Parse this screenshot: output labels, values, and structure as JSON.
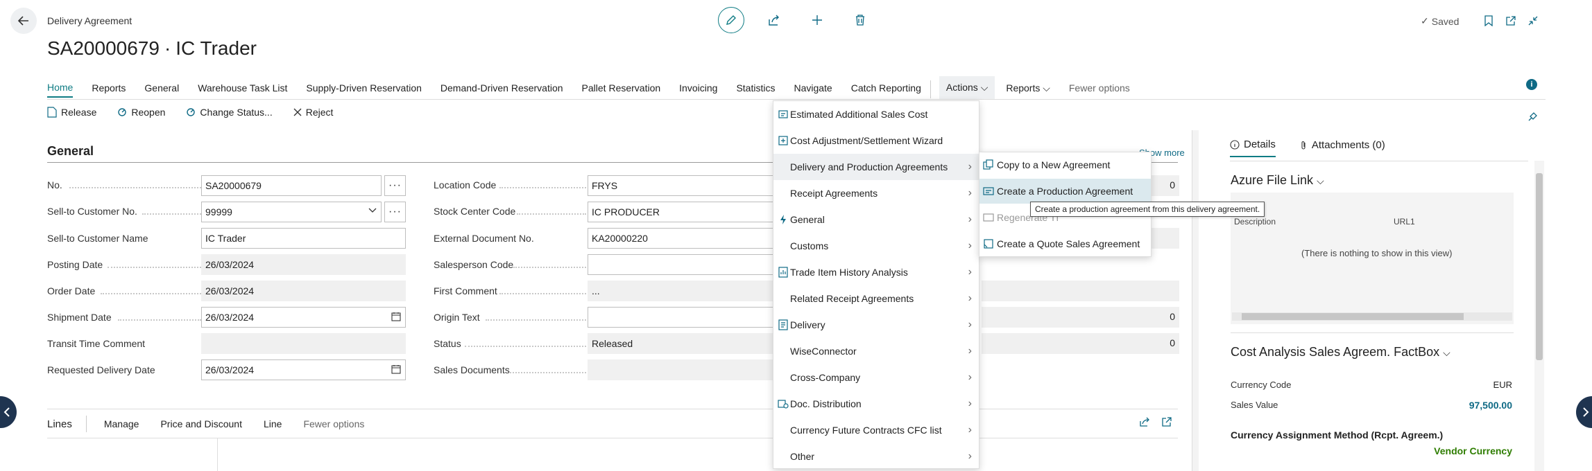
{
  "header": {
    "subtitle": "Delivery Agreement",
    "title": "SA20000679 ∙ IC Trader",
    "saved": "Saved"
  },
  "tabs": [
    {
      "label": "Home"
    },
    {
      "label": "Reports"
    },
    {
      "label": "General"
    },
    {
      "label": "Warehouse Task List"
    },
    {
      "label": "Supply-Driven Reservation"
    },
    {
      "label": "Demand-Driven Reservation"
    },
    {
      "label": "Pallet Reservation"
    },
    {
      "label": "Invoicing"
    },
    {
      "label": "Statistics"
    },
    {
      "label": "Navigate"
    },
    {
      "label": "Catch Reporting"
    }
  ],
  "tabs_right": {
    "actions": "Actions",
    "reports": "Reports",
    "fewer": "Fewer options"
  },
  "toolbar": {
    "release": "Release",
    "reopen": "Reopen",
    "change_status": "Change Status...",
    "reject": "Reject"
  },
  "general": {
    "title": "General",
    "show_more": "Show more",
    "left_fields": [
      {
        "label": "No.",
        "value": "SA20000679"
      },
      {
        "label": "Sell-to Customer No.",
        "value": "99999"
      },
      {
        "label": "Sell-to Customer Name",
        "value": "IC Trader"
      },
      {
        "label": "Posting Date",
        "value": "26/03/2024"
      },
      {
        "label": "Order Date",
        "value": "26/03/2024"
      },
      {
        "label": "Shipment Date",
        "value": "26/03/2024"
      },
      {
        "label": "Transit Time Comment",
        "value": ""
      },
      {
        "label": "Requested Delivery Date",
        "value": "26/03/2024"
      }
    ],
    "mid_fields": [
      {
        "label": "Location Code",
        "value": "FRYS"
      },
      {
        "label": "Stock Center Code",
        "value": "IC PRODUCER"
      },
      {
        "label": "External Document No.",
        "value": "KA20000220"
      },
      {
        "label": "Salesperson Code",
        "value": ""
      },
      {
        "label": "First Comment",
        "value": "..."
      },
      {
        "label": "Origin Text",
        "value": ""
      },
      {
        "label": "Status",
        "value": "Released"
      },
      {
        "label": "Sales Documents",
        "value": ""
      }
    ],
    "right_values": [
      "0",
      "",
      "",
      "",
      "",
      "0",
      "0"
    ]
  },
  "lines_bar": {
    "lines": "Lines",
    "manage": "Manage",
    "price": "Price and Discount",
    "line": "Line",
    "fewer": "Fewer options"
  },
  "actions_menu": [
    {
      "label": "Estimated Additional Sales Cost",
      "icon": "cost-icon",
      "sub": false
    },
    {
      "label": "Cost Adjustment/Settlement Wizard",
      "icon": "wizard-icon",
      "sub": false
    },
    {
      "label": "Delivery and Production Agreements",
      "icon": "",
      "sub": true
    },
    {
      "label": "Receipt Agreements",
      "icon": "",
      "sub": true
    },
    {
      "label": "General",
      "icon": "lightning-icon",
      "sub": true
    },
    {
      "label": "Customs",
      "icon": "",
      "sub": true
    },
    {
      "label": "Trade Item History Analysis",
      "icon": "analysis-icon",
      "sub": true
    },
    {
      "label": "Related Receipt Agreements",
      "icon": "",
      "sub": true
    },
    {
      "label": "Delivery",
      "icon": "document-icon",
      "sub": true
    },
    {
      "label": "WiseConnector",
      "icon": "",
      "sub": true
    },
    {
      "label": "Cross-Company",
      "icon": "",
      "sub": true
    },
    {
      "label": "Doc. Distribution",
      "icon": "distribution-icon",
      "sub": true
    },
    {
      "label": "Currency Future Contracts CFC list",
      "icon": "",
      "sub": true
    },
    {
      "label": "Other",
      "icon": "",
      "sub": true
    }
  ],
  "submenu": [
    {
      "label": "Copy to a New Agreement"
    },
    {
      "label": "Create a Production Agreement"
    },
    {
      "label": "Regenerate TI"
    },
    {
      "label": "Create a Quote Sales Agreement"
    }
  ],
  "tooltip": "Create a production agreement from this delivery agreement.",
  "factbox": {
    "details_tab": "Details",
    "attachments_tab": "Attachments (0)",
    "azure_title": "Azure File Link",
    "col_description": "Description",
    "col_url": "URL1",
    "empty": "(There is nothing to show in this view)",
    "cost_title": "Cost Analysis Sales Agreem. FactBox",
    "currency_code_label": "Currency Code",
    "currency_code_value": "EUR",
    "sales_value_label": "Sales Value",
    "sales_value": "97,500.00",
    "assignment_label": "Currency Assignment Method (Rcpt. Agreem.)",
    "assignment_value": "Vendor Currency"
  },
  "colors": {
    "accent": "#0f7c84",
    "link": "#0f6a85",
    "green": "#2e7d00",
    "nav": "#1f3450"
  }
}
